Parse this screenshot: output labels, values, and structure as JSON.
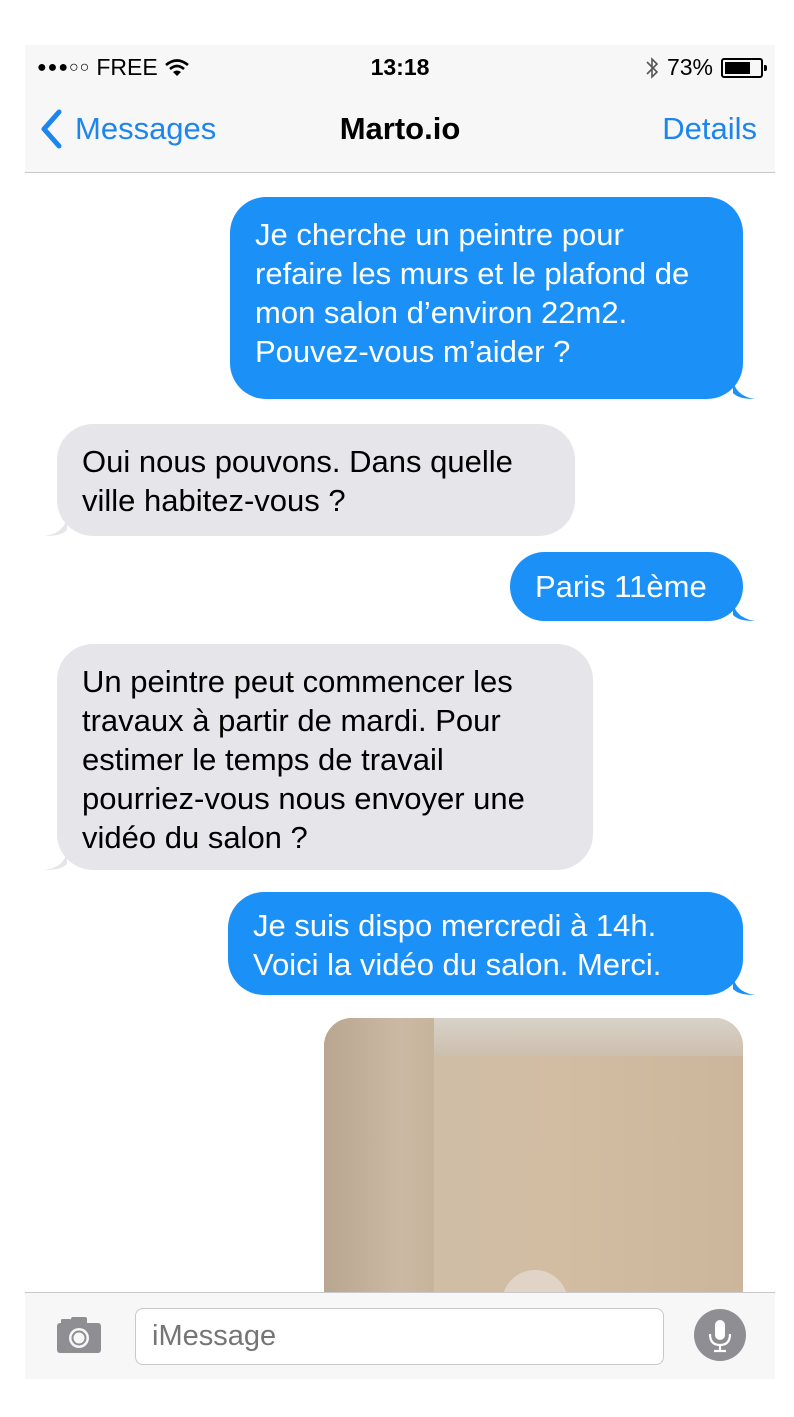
{
  "status_bar": {
    "signal": "●●●○○",
    "carrier": "FREE",
    "time": "13:18",
    "battery_percent": "73%",
    "battery_level": 0.73
  },
  "nav": {
    "back_label": "Messages",
    "title": "Marto.io",
    "details_label": "Details"
  },
  "messages": [
    {
      "direction": "outgoing",
      "lines": [
        "Je cherche un peintre pour",
        "refaire les murs et le plafond de",
        "mon salon d’environ 22m2.",
        "Pouvez-vous m’aider ?"
      ]
    },
    {
      "direction": "incoming",
      "lines": [
        "Oui nous pouvons. Dans quelle",
        "ville habitez-vous ?"
      ]
    },
    {
      "direction": "outgoing",
      "lines": [
        "Paris 11ème"
      ]
    },
    {
      "direction": "incoming",
      "lines": [
        "Un peintre peut commencer les",
        "travaux à partir de mardi. Pour",
        "estimer le temps de travail",
        "pourriez-vous nous envoyer une",
        "vidéo du salon ?"
      ]
    },
    {
      "direction": "outgoing",
      "lines": [
        "Je suis dispo mercredi à 14h.",
        "Voici la vidéo du salon. Merci."
      ]
    }
  ],
  "input": {
    "placeholder": "iMessage"
  },
  "colors": {
    "accent": "#1c86ee",
    "outgoing_bubble": "#1b91f8",
    "incoming_bubble": "#e5e5ea",
    "bar_background": "#f7f7f7"
  },
  "icons": {
    "back": "chevron-left-icon",
    "camera": "camera-icon",
    "mic": "microphone-icon",
    "wifi": "wifi-icon",
    "bluetooth": "bluetooth-icon"
  }
}
